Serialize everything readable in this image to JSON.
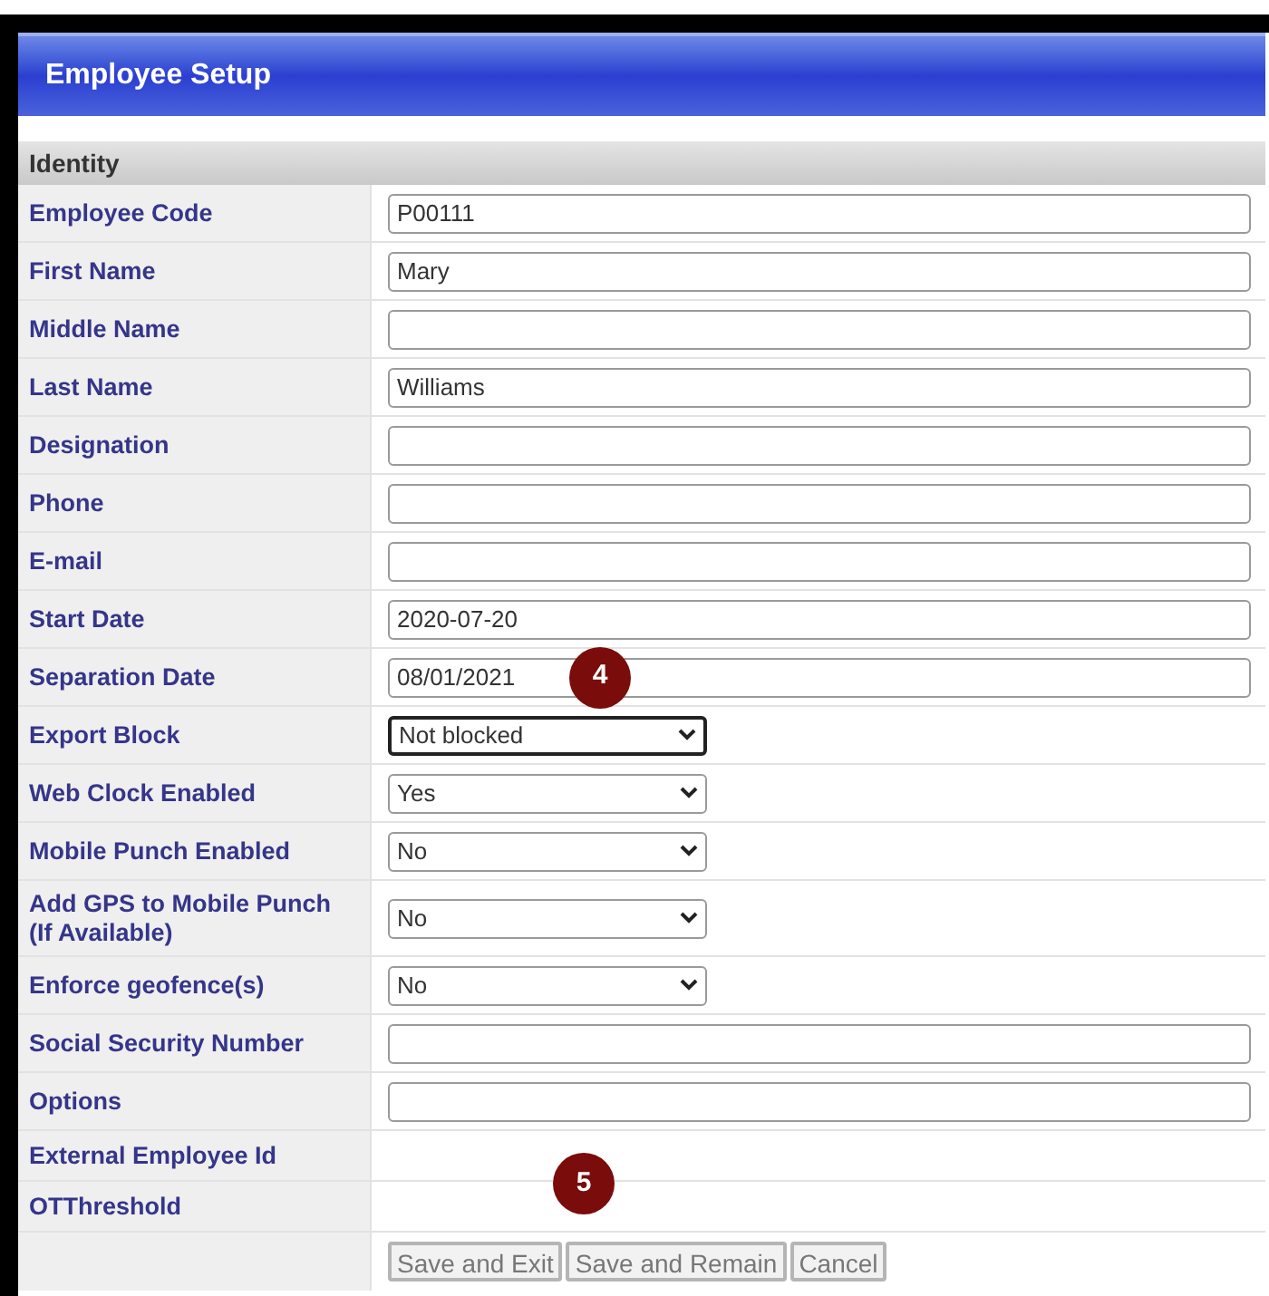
{
  "window": {
    "title": "Employee Setup"
  },
  "section": {
    "title": "Identity"
  },
  "fields": [
    {
      "label": "Employee Code",
      "kind": "text",
      "value": "P00111"
    },
    {
      "label": "First Name",
      "kind": "text",
      "value": "Mary"
    },
    {
      "label": "Middle Name",
      "kind": "text"
    },
    {
      "label": "Last Name",
      "kind": "text",
      "value": "Williams"
    },
    {
      "label": "Designation",
      "kind": "text"
    },
    {
      "label": "Phone",
      "kind": "text"
    },
    {
      "label": "E-mail",
      "kind": "text"
    },
    {
      "label": "Start Date",
      "kind": "text",
      "value": "2020-07-20"
    },
    {
      "label": "Separation Date",
      "kind": "text",
      "value": "08/01/2021",
      "callout": "4"
    },
    {
      "label": "Export Block",
      "kind": "select",
      "value": "Not blocked",
      "focused": true
    },
    {
      "label": "Web Clock Enabled",
      "kind": "select",
      "value": "Yes",
      "focused": false
    },
    {
      "label": "Mobile Punch Enabled",
      "kind": "select",
      "value": "No",
      "focused": false
    },
    {
      "label": "Add GPS to Mobile Punch (If Available)",
      "kind": "select",
      "value": "No",
      "focused": false
    },
    {
      "label": "Enforce geofence(s)",
      "kind": "select",
      "value": "No",
      "focused": false
    },
    {
      "label": "Social Security Number",
      "kind": "text"
    },
    {
      "label": "Options",
      "kind": "text"
    },
    {
      "label": "External Employee Id",
      "kind": "none"
    },
    {
      "label": "OTThreshold",
      "kind": "none",
      "callout": "5"
    }
  ],
  "buttons": [
    "Save and Exit",
    "Save and Remain",
    "Cancel"
  ]
}
